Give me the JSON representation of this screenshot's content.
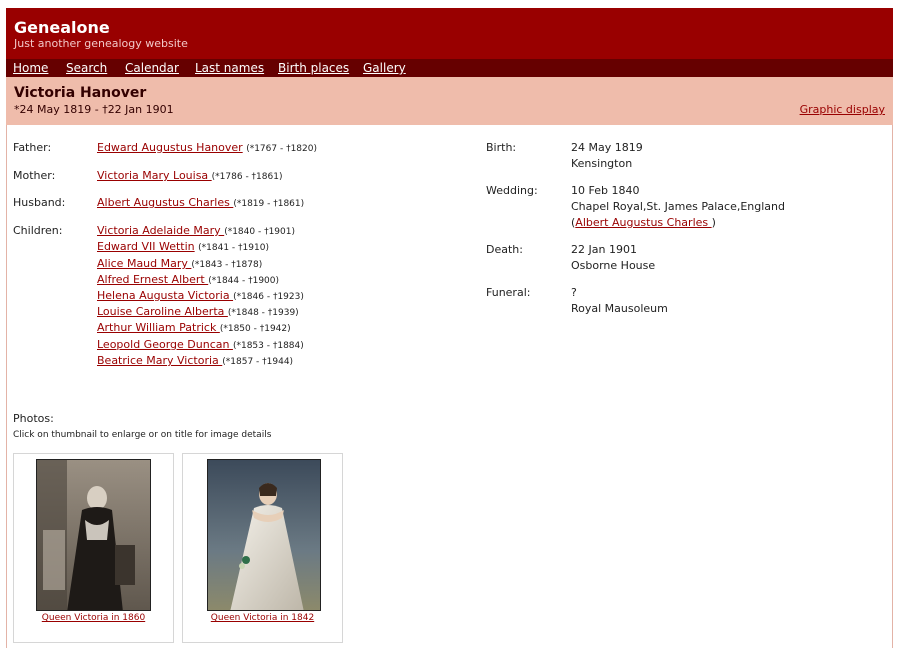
{
  "site": {
    "title": "Genealone",
    "tagline": "Just another genealogy website"
  },
  "nav": {
    "items": [
      {
        "label": "Home"
      },
      {
        "label": "Search"
      },
      {
        "label": "Calendar"
      },
      {
        "label": "Last names"
      },
      {
        "label": "Birth places"
      },
      {
        "label": "Gallery"
      }
    ]
  },
  "person": {
    "name": "Victoria Hanover",
    "dates": "*24 May 1819 - †22 Jan 1901",
    "graphic_display_label": "Graphic display"
  },
  "relations": {
    "father": {
      "label": "Father:",
      "name": "Edward Augustus Hanover",
      "span": "(*1767 - †1820)"
    },
    "mother": {
      "label": "Mother:",
      "name": "Victoria Mary Louisa ",
      "span": "(*1786 - †1861)"
    },
    "husband": {
      "label": "Husband:",
      "name": "Albert Augustus Charles ",
      "span": "(*1819 - †1861)"
    },
    "children_label": "Children:",
    "children": [
      {
        "name": "Victoria Adelaide Mary ",
        "span": "(*1840 - †1901)"
      },
      {
        "name": "Edward VII Wettin",
        "span": "(*1841 - †1910)"
      },
      {
        "name": "Alice Maud Mary ",
        "span": "(*1843 - †1878)"
      },
      {
        "name": "Alfred Ernest Albert ",
        "span": "(*1844 - †1900)"
      },
      {
        "name": "Helena Augusta Victoria ",
        "span": "(*1846 - †1923)"
      },
      {
        "name": "Louise Caroline Alberta ",
        "span": "(*1848 - †1939)"
      },
      {
        "name": "Arthur William Patrick ",
        "span": "(*1850 - †1942)"
      },
      {
        "name": "Leopold George Duncan ",
        "span": "(*1853 - †1884)"
      },
      {
        "name": "Beatrice Mary Victoria ",
        "span": "(*1857 - †1944)"
      }
    ]
  },
  "events": {
    "birth": {
      "label": "Birth:",
      "date": "24 May 1819",
      "place": "Kensington"
    },
    "wedding": {
      "label": "Wedding:",
      "date": "10 Feb 1840",
      "place": "Chapel Royal,St. James Palace,England",
      "spouse_prefix": "(",
      "spouse": "Albert Augustus Charles ",
      "spouse_suffix": ")"
    },
    "death": {
      "label": "Death:",
      "date": "22 Jan 1901",
      "place": "Osborne House"
    },
    "funeral": {
      "label": "Funeral:",
      "date": "?",
      "place": "Royal Mausoleum"
    }
  },
  "photos": {
    "label": "Photos:",
    "hint": "Click on thumbnail to enlarge or on title for image details",
    "items": [
      {
        "caption": "Queen Victoria in 1860"
      },
      {
        "caption": "Queen Victoria in 1842"
      }
    ]
  },
  "colors": {
    "header_bg": "#990000",
    "nav_bg": "#660000",
    "person_bar_bg": "#efbcab",
    "link": "#990000"
  }
}
